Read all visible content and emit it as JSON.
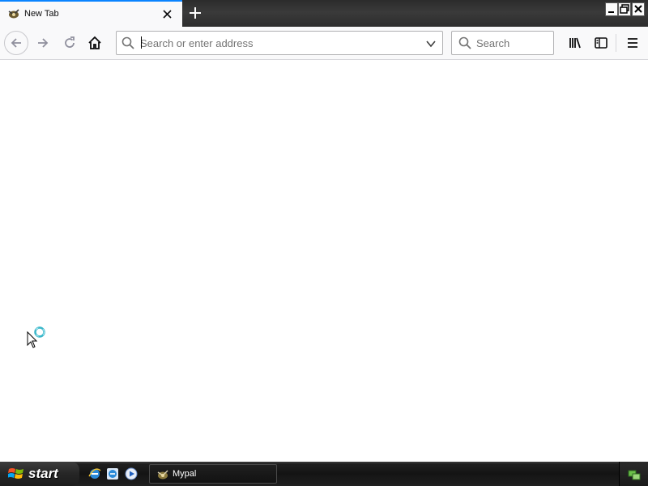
{
  "browser": {
    "tab": {
      "title": "New Tab",
      "icon": "mypal-icon"
    },
    "urlbar": {
      "placeholder": "Search or enter address",
      "value": ""
    },
    "searchbar": {
      "placeholder": "Search"
    }
  },
  "taskbar": {
    "start_label": "start",
    "quick_launch": [
      "internet-explorer-icon",
      "internet-explorer-icon",
      "media-player-icon"
    ],
    "task_item_label": "Mypal",
    "tray_icon": "network-icon"
  },
  "colors": {
    "tab_accent": "#0a84ff",
    "toolbar_bg": "#f9f9fa",
    "taskbar_bg": "#1a1a1a"
  }
}
